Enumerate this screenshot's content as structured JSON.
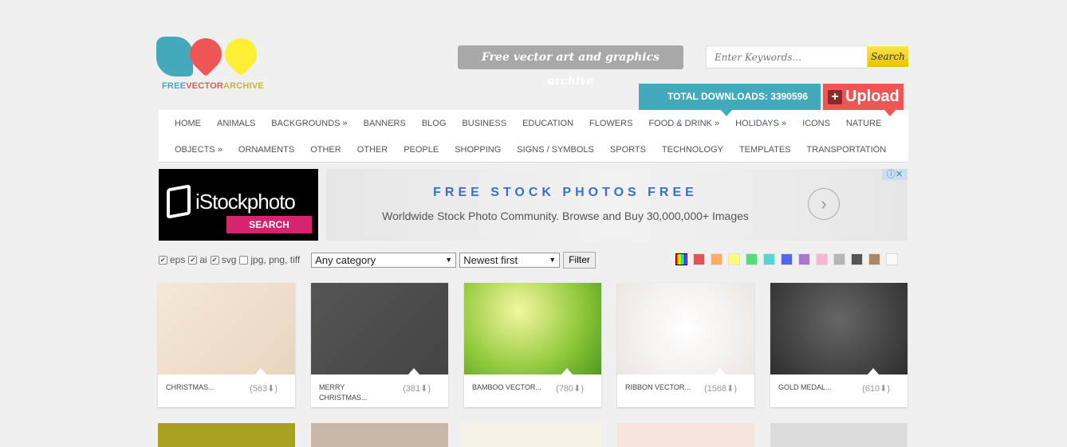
{
  "logo": {
    "part1": "FREE",
    "part2": "VECTOR",
    "part3": "ARCHIVE"
  },
  "tagline": "Free vector art and graphics archive",
  "search": {
    "placeholder": "Enter Keywords...",
    "button": "Search"
  },
  "downloads": "TOTAL DOWNLOADS: 3390596",
  "upload": {
    "plus": "+",
    "label": "Upload"
  },
  "nav": {
    "row1": [
      "HOME",
      "ANIMALS",
      "BACKGROUNDS »",
      "BANNERS",
      "BLOG",
      "BUSINESS",
      "EDUCATION",
      "FLOWERS",
      "FOOD & DRINK »",
      "HOLIDAYS »",
      "ICONS",
      "NATURE"
    ],
    "row2": [
      "OBJECTS »",
      "ORNAMENTS",
      "OTHER",
      "OTHER",
      "PEOPLE",
      "SHOPPING",
      "SIGNS / SYMBOLS",
      "SPORTS",
      "TECHNOLOGY",
      "TEMPLATES",
      "TRANSPORTATION"
    ]
  },
  "ad": {
    "brand": "iStockphoto",
    "search": "SEARCH",
    "headline": "FREE STOCK PHOTOS FREE",
    "sub": "Worldwide Stock Photo Community. Browse and Buy 30,000,000+ Images"
  },
  "filters": {
    "formats": [
      {
        "label": "eps",
        "checked": true
      },
      {
        "label": "ai",
        "checked": true
      },
      {
        "label": "svg",
        "checked": true
      },
      {
        "label": "jpg, png, tiff",
        "checked": false
      }
    ],
    "category": "Any category",
    "sort": "Newest first",
    "button": "Filter"
  },
  "colors": [
    "#dd5555",
    "#ffaa66",
    "#ffff77",
    "#55dd77",
    "#55d5d5",
    "#5566ee",
    "#aa77cc",
    "#ffb3d5",
    "#b5b5b5",
    "#555555",
    "#aa8866",
    "#fafafa"
  ],
  "cards": [
    {
      "title": "CHRISTMAS...",
      "count": "(563⬇)",
      "bg": "linear-gradient(135deg,#f5e8d8,#e8d5bf)"
    },
    {
      "title": "MERRY CHRISTMAS...",
      "count": "(381⬇)",
      "bg": "linear-gradient(135deg,#555,#444)"
    },
    {
      "title": "BAMBOO VECTOR...",
      "count": "(780⬇)",
      "bg": "radial-gradient(circle at 40% 30%,#f4f7a0,#8fc83a 60%,#4e9a1e)"
    },
    {
      "title": "RIBBON VECTOR...",
      "count": "(1568⬇)",
      "bg": "radial-gradient(circle,#fff,#ece6e2)"
    },
    {
      "title": "GOLD MEDAL...",
      "count": "(610⬇)",
      "bg": "radial-gradient(circle at 50% 40%,#666,#2e2e2e)"
    }
  ],
  "row2bg": [
    "#a8a020",
    "#c9b8a8",
    "#f7f2e6",
    "#f5e4dc",
    "#dcdcdc"
  ]
}
